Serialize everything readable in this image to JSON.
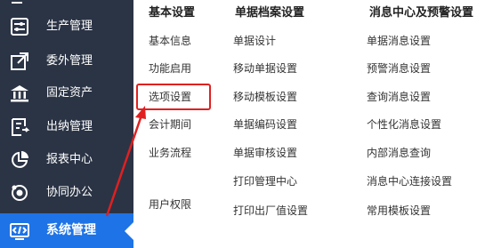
{
  "sidebar": {
    "items": [
      {
        "label": "生产管理",
        "icon": "sliders-icon"
      },
      {
        "label": "委外管理",
        "icon": "outsource-icon"
      },
      {
        "label": "固定资产",
        "icon": "bank-icon"
      },
      {
        "label": "出纳管理",
        "icon": "cashier-icon"
      },
      {
        "label": "报表中心",
        "icon": "pie-chart-icon"
      },
      {
        "label": "协同办公",
        "icon": "collaboration-icon"
      },
      {
        "label": "系统管理",
        "icon": "system-code-icon"
      }
    ],
    "active_index": 6,
    "active_color": "#1e73e6",
    "bg_color": "#2b3445"
  },
  "menu": {
    "columns": [
      {
        "title": "基本设置",
        "items": [
          "基本信息",
          "功能启用",
          "选项设置",
          "会计期间",
          "业务流程",
          "用户权限"
        ]
      },
      {
        "title": "单据档案设置",
        "items": [
          "单据设计",
          "移动单据设置",
          "移动模板设置",
          "单据编码设置",
          "单据审核设置",
          "打印管理中心",
          "打印出厂值设置"
        ]
      },
      {
        "title": "消息中心及预警设置",
        "items": [
          "单据消息设置",
          "预警消息设置",
          "查询消息设置",
          "个性化消息设置",
          "内部消息查询",
          "消息中心连接设置",
          "常用模板设置"
        ]
      }
    ]
  },
  "annotation": {
    "highlight_color": "#e02020",
    "highlighted_item": "选项设置"
  }
}
